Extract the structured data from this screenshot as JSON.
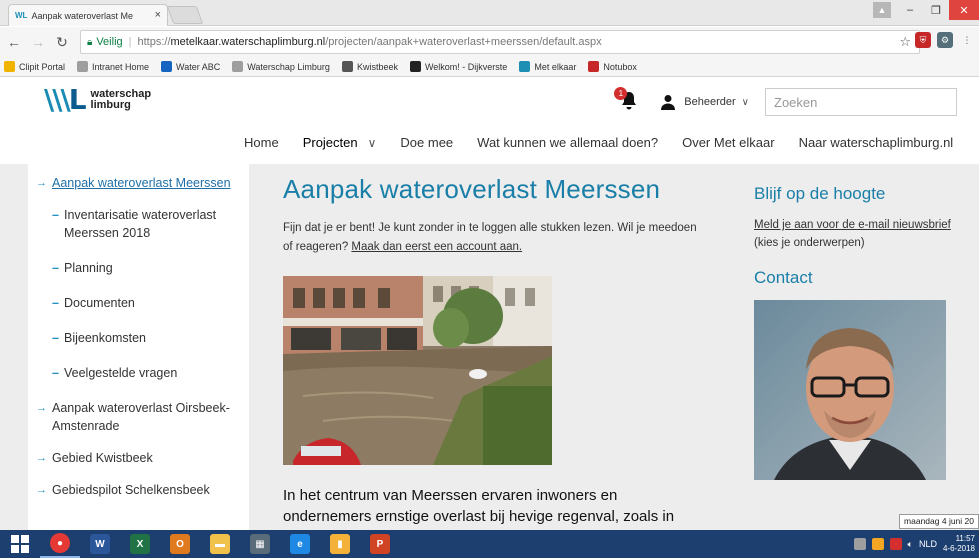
{
  "browser": {
    "tab_title": "Aanpak wateroverlast Me",
    "tab_logo": "WL",
    "secure_label": "Veilig",
    "url_scheme": "https://",
    "url_host": "metelkaar.waterschaplimburg.nl",
    "url_path": "/projecten/aanpak+wateroverlast+meerssen/default.aspx",
    "bookmarks": [
      {
        "label": "Clipit Portal",
        "icon": "folder-icon",
        "color": "#f0b400"
      },
      {
        "label": "Intranet Home",
        "icon": "page-icon",
        "color": "#9e9e9e"
      },
      {
        "label": "Water ABC",
        "icon": "figure-icon",
        "color": "#1565c0"
      },
      {
        "label": "Waterschap Limburg",
        "icon": "page-icon",
        "color": "#9e9e9e"
      },
      {
        "label": "Kwistbeek",
        "icon": "circle-icon",
        "color": "#555555"
      },
      {
        "label": "Welkom! - Dijkverste",
        "icon": "m-logo-icon",
        "color": "#222222"
      },
      {
        "label": "Met elkaar",
        "icon": "wl-logo-icon",
        "color": "#1d8fb5"
      },
      {
        "label": "Notubox",
        "icon": "notubox-icon",
        "color": "#c62828"
      }
    ]
  },
  "site": {
    "logo_text_line1": "waterschap",
    "logo_text_line2": "limburg",
    "notification_count": "1",
    "user_label": "Beheerder",
    "search_placeholder": "Zoeken",
    "nav": [
      "Home",
      "Projecten",
      "Doe mee",
      "Wat kunnen we allemaal doen?",
      "Over Met elkaar",
      "Naar waterschaplimburg.nl"
    ]
  },
  "sidebar": {
    "items": [
      {
        "label": "Aanpak wateroverlast Meerssen",
        "type": "item",
        "active": true
      },
      {
        "label": "Inventarisatie wateroverlast Meerssen 2018",
        "type": "sub"
      },
      {
        "label": "Planning",
        "type": "sub"
      },
      {
        "label": "Documenten",
        "type": "sub"
      },
      {
        "label": "Bijeenkomsten",
        "type": "sub"
      },
      {
        "label": "Veelgestelde vragen",
        "type": "sub"
      },
      {
        "label": "Aanpak wateroverlast Oirsbeek-Amstenrade",
        "type": "item"
      },
      {
        "label": "Gebied Kwistbeek",
        "type": "item"
      },
      {
        "label": "Gebiedspilot Schelkensbeek",
        "type": "item"
      }
    ]
  },
  "main": {
    "title": "Aanpak wateroverlast Meerssen",
    "intro_text": "Fijn dat je er bent! Je kunt zonder in te loggen alle stukken lezen. Wil je meedoen of reageren? ",
    "intro_link": "Maak dan eerst een account aan.",
    "lead": "In het centrum van Meerssen ervaren inwoners en ondernemers ernstige overlast bij hevige regenval, zoals in"
  },
  "aside": {
    "heading": "Blijf op de hoogte",
    "newsletter_link": "Meld je aan voor de e-mail nieuwsbrief",
    "newsletter_note": "(kies je onderwerpen)",
    "contact_heading": "Contact"
  },
  "taskbar": {
    "tooltip": "maandag 4 juni 20",
    "language": "NLD",
    "time": "11:57",
    "date": "4-6-2018"
  },
  "colors": {
    "accent": "#1a7fa8",
    "taskbar": "#1c3f70",
    "sidebar_arrow": "#1e8fbf"
  }
}
